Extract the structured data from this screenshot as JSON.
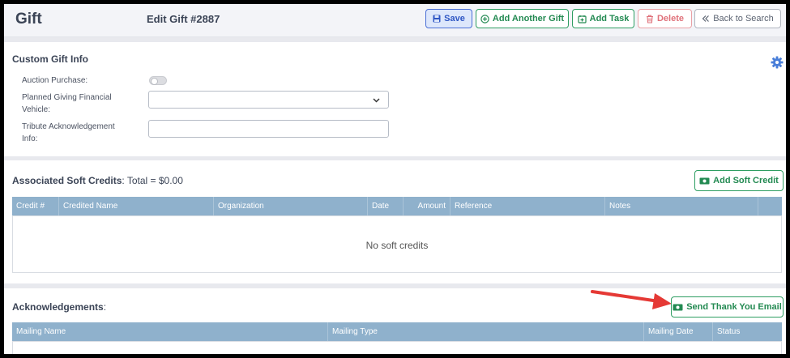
{
  "header": {
    "app_title": "Gift",
    "page_title": "Edit Gift #2887"
  },
  "toolbar": {
    "save": "Save",
    "add_another_gift": "Add Another Gift",
    "add_task": "Add Task",
    "delete": "Delete",
    "back_to_search": "Back to Search"
  },
  "custom_gift_info": {
    "title": "Custom Gift Info",
    "auction_label": "Auction Purchase:",
    "auction_value": "off",
    "planned_giving_label_line1": "Planned Giving Financial",
    "planned_giving_label_line2": "Vehicle:",
    "planned_giving_value": "",
    "tribute_label_line1": "Tribute Acknowledgement",
    "tribute_label_line2": "Info:",
    "tribute_value": ""
  },
  "soft_credits": {
    "title": "Associated Soft Credits",
    "total_text": ": Total = $0.00",
    "add_button": "Add Soft Credit",
    "columns": [
      "Credit #",
      "Credited Name",
      "Organization",
      "Date",
      "Amount",
      "Reference",
      "Notes"
    ],
    "empty_message": "No soft credits"
  },
  "acknowledgements": {
    "title": "Acknowledgements",
    "title_suffix": ":",
    "send_button": "Send Thank You Email",
    "columns": [
      "Mailing Name",
      "Mailing Type",
      "Mailing Date",
      "Status"
    ]
  },
  "colors": {
    "primary": "#2e56c4",
    "success": "#238a52",
    "danger": "#e0727b",
    "table_header": "#8fb1cc",
    "arrow": "#e53935"
  },
  "icons": [
    "save-icon",
    "plus-circle-icon",
    "calendar-plus-icon",
    "trash-icon",
    "double-chevron-left-icon",
    "gear-icon",
    "chevron-down-icon",
    "money-icon",
    "money-send-icon"
  ]
}
